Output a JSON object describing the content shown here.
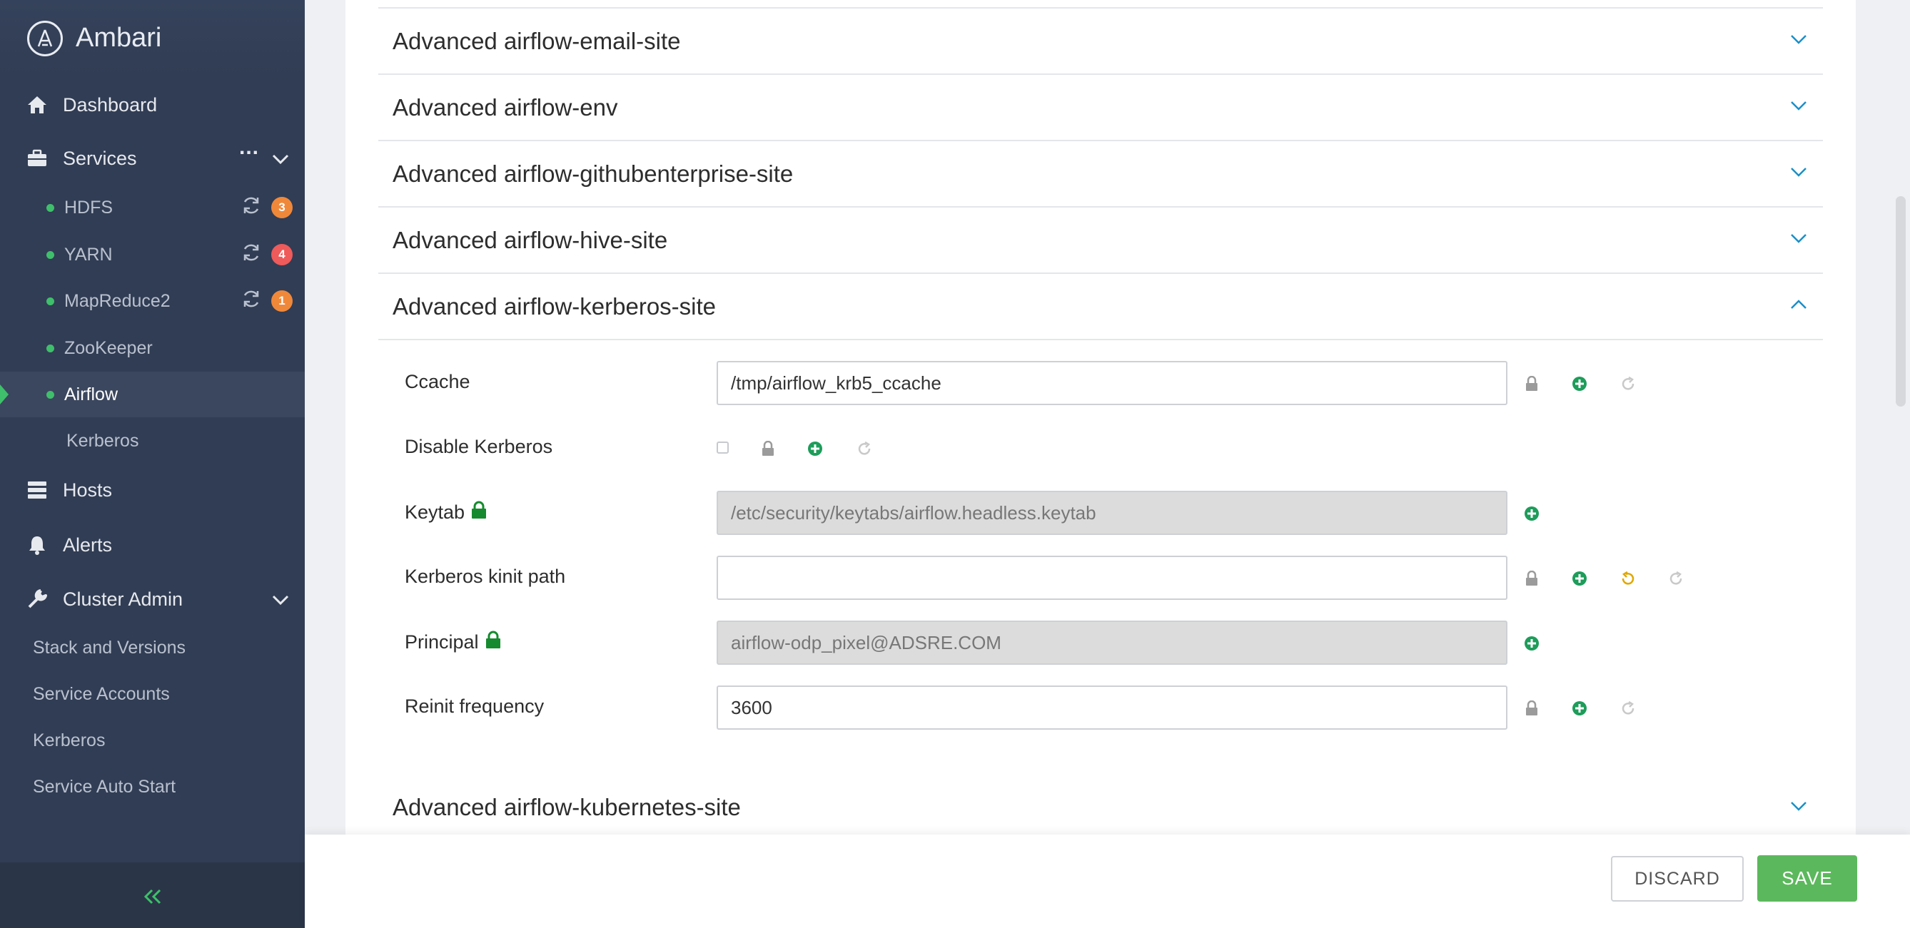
{
  "app": {
    "name": "Ambari"
  },
  "sidebar": {
    "nav": {
      "dashboard": "Dashboard",
      "services": "Services",
      "services_more": "...",
      "hosts": "Hosts",
      "alerts": "Alerts",
      "cluster_admin": "Cluster Admin"
    },
    "services": [
      {
        "label": "HDFS",
        "badge": "3",
        "badge_color": "#f0883a"
      },
      {
        "label": "YARN",
        "badge": "4",
        "badge_color": "#ef5a5a"
      },
      {
        "label": "MapReduce2",
        "badge": "1",
        "badge_color": "#f0883a"
      },
      {
        "label": "ZooKeeper"
      },
      {
        "label": "Airflow",
        "active": true
      },
      {
        "label": "Kerberos"
      }
    ],
    "cluster_admin_items": [
      "Stack and Versions",
      "Service Accounts",
      "Kerberos",
      "Service Auto Start"
    ],
    "collapse_icon": "double-chevron-left-icon"
  },
  "sections": [
    {
      "title": "Advanced airflow-email-site",
      "expanded": false
    },
    {
      "title": "Advanced airflow-env",
      "expanded": false
    },
    {
      "title": "Advanced airflow-githubenterprise-site",
      "expanded": false
    },
    {
      "title": "Advanced airflow-hive-site",
      "expanded": false
    },
    {
      "title": "Advanced airflow-kerberos-site",
      "expanded": true
    },
    {
      "title": "Advanced airflow-kubernetes-site",
      "expanded": false
    }
  ],
  "kerberos_site": {
    "ccache": {
      "label": "Ccache",
      "value": "/tmp/airflow_krb5_ccache"
    },
    "disable_kerberos": {
      "label": "Disable Kerberos",
      "checked": false
    },
    "keytab": {
      "label": "Keytab",
      "value": "/etc/security/keytabs/airflow.headless.keytab"
    },
    "kinit_path": {
      "label": "Kerberos kinit path",
      "value": ""
    },
    "principal": {
      "label": "Principal",
      "value": "airflow-odp_pixel@ADSRE.COM"
    },
    "reinit_frequency": {
      "label": "Reinit frequency",
      "value": "3600"
    }
  },
  "footer": {
    "discard": "DISCARD",
    "save": "SAVE"
  },
  "colors": {
    "accent_green": "#5cb85c",
    "chevron_blue": "#1a8fc9",
    "sidebar_bg": "#313d54"
  }
}
